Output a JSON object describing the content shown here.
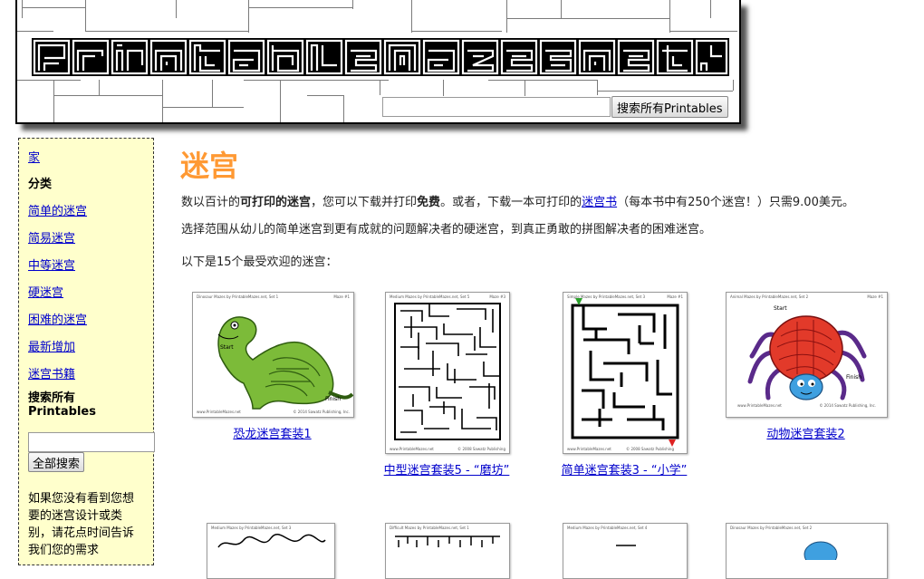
{
  "header": {
    "logo_text": "PrintableMazes.net",
    "search_placeholder": "",
    "search_button": "搜索所有Printables"
  },
  "sidebar": {
    "home": "家",
    "categories_heading": "分类",
    "items": [
      "简单的迷宫",
      "简易迷宫",
      "中等迷宫",
      "硬迷宫",
      "困难的迷宫",
      "最新增加",
      "迷宫书籍"
    ],
    "search_heading": "搜索所有Printables",
    "search_button": "全部搜索",
    "note": "如果您没有看到您想要的迷宫设计或类别，请花点时间告诉我们您的需求"
  },
  "main": {
    "title": "迷宫",
    "p1": {
      "a": "数以百计的",
      "b": "可打印的迷宫",
      "c": "，您可以下载并打印",
      "d": "免费",
      "e": "。或者，下载一本可打印的",
      "link": "迷宫书",
      "f": "（每本书中有250个迷宫！）只需9.00美元。"
    },
    "p2": "选择范围从幼儿的简单迷宫到更有成就的问题解决者的硬迷宫，到真正勇敢的拼图解决者的困难迷宫。",
    "p3": "以下是15个最受欢迎的迷宫：",
    "mazes": [
      {
        "caption": "恐龙迷宫套装1",
        "header": "Dinosaur Mazes by PrintableMazes.net, Set 1",
        "num": "Maze #1",
        "start": "Start",
        "finish": "Finish",
        "footer_left": "www.PrintableMazes.net",
        "footer_right": "© 2014 Sawatz Publishing, Inc."
      },
      {
        "caption": "中型迷宫套装5 - “磨坊”",
        "header": "Medium Mazes by PrintableMazes.net, Set 5",
        "num": "Maze #3",
        "footer_left": "www.PrintableMazes.net",
        "footer_right": "© 2008 Sawatz Publishing"
      },
      {
        "caption": "简单迷宫套装3 - “小学”",
        "header": "Simple Mazes by PrintableMazes.net, Set 3",
        "num": "Maze #1",
        "footer_left": "www.PrintableMazes.net",
        "footer_right": "© 2008 Sawatz Publishing"
      },
      {
        "caption": "动物迷宫套装2",
        "header": "Animal Mazes by PrintableMazes.net, Set 2",
        "num": "Maze #1",
        "start": "Start",
        "finish": "Finish",
        "footer_left": "www.PrintableMazes.net",
        "footer_right": "© 2014 Sawatz Publishing, Inc."
      }
    ],
    "row2_headers": [
      "Medium Mazes by PrintableMazes.net, Set 3",
      "Difficult Mazes by PrintableMazes.net, Set 1",
      "Medium Mazes by PrintableMazes.net, Set 4",
      "Dinosaur Mazes by PrintableMazes.net, Set 2"
    ]
  },
  "colors": {
    "title": "#ff9933",
    "sidebar_bg": "#ffffcc",
    "link": "#0000cc"
  }
}
